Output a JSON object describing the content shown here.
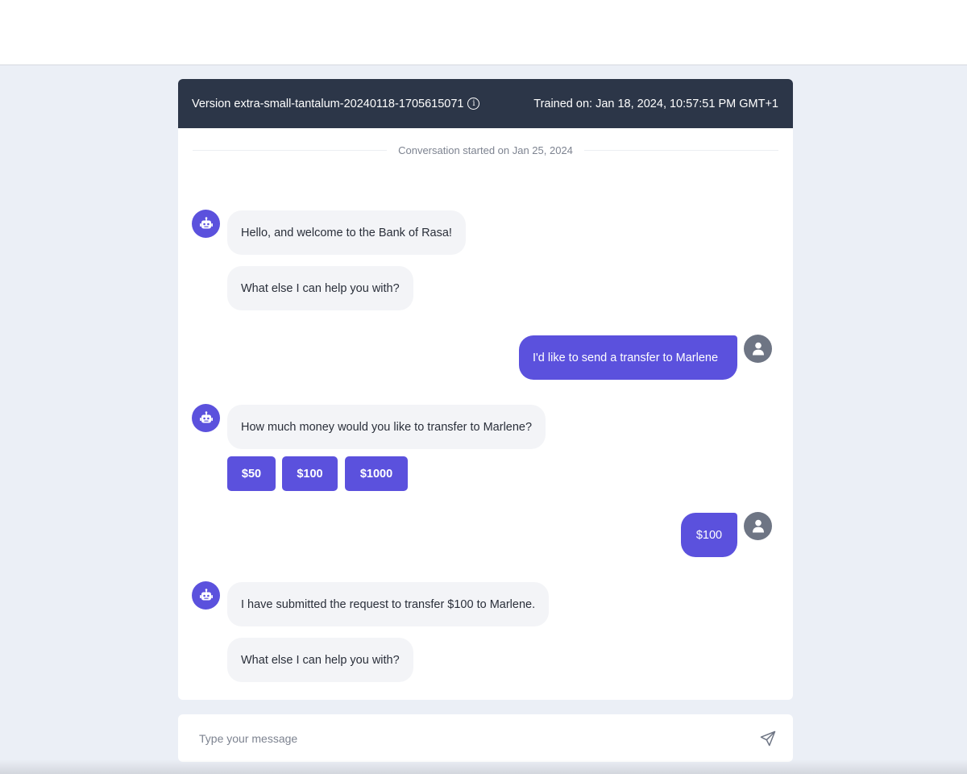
{
  "header": {
    "version_label": "Version extra-small-tantalum-20240118-1705615071",
    "trained_label": "Trained on: Jan 18, 2024, 10:57:51 PM GMT+1"
  },
  "conversation": {
    "started_label": "Conversation started on Jan 25, 2024",
    "messages": [
      {
        "sender": "bot",
        "text": "Hello, and welcome to the Bank of Rasa!"
      },
      {
        "sender": "bot",
        "text": "What else I can help you with?"
      },
      {
        "sender": "user",
        "text": "I'd like to send a transfer to Marlene"
      },
      {
        "sender": "bot",
        "text": "How much money would you like to transfer to Marlene?"
      },
      {
        "sender": "user",
        "text": "$100"
      },
      {
        "sender": "bot",
        "text": "I have submitted the request to transfer $100 to Marlene."
      },
      {
        "sender": "bot",
        "text": "What else I can help you with?"
      }
    ],
    "quick_replies": [
      "$50",
      "$100",
      "$1000"
    ]
  },
  "composer": {
    "placeholder": "Type your message"
  },
  "icons": {
    "bot_avatar": "robot-icon",
    "user_avatar": "user-icon",
    "info": "info-icon",
    "send": "send-icon"
  },
  "colors": {
    "accent": "#5b51dd",
    "header_bg": "#2c3648",
    "bot_bubble": "#f3f4f7",
    "user_avatar": "#6e7584",
    "page_bg": "#ebeff6"
  }
}
